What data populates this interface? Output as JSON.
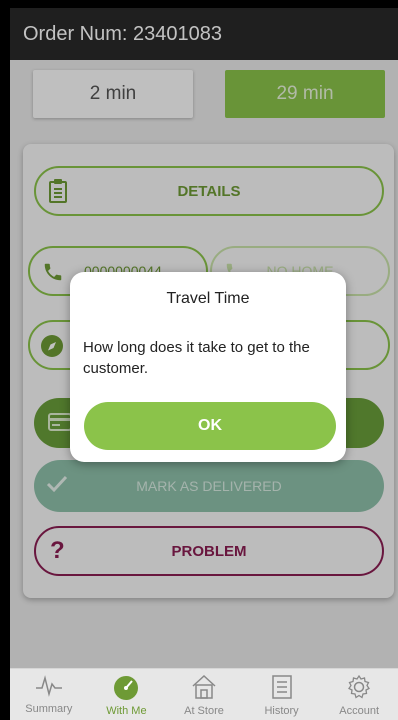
{
  "header": {
    "title": "Order Num: 23401083"
  },
  "times": {
    "left": "2 min",
    "right": "29 min"
  },
  "actions": {
    "details": "DETAILS",
    "phone": "0000000044",
    "no_home": "NO HOME",
    "mark_delivered": "MARK AS DELIVERED",
    "problem": "PROBLEM",
    "problem_icon": "?"
  },
  "dialog": {
    "title": "Travel Time",
    "message": "How long does it take to get to the customer.",
    "ok": "OK"
  },
  "tabs": [
    {
      "label": "Summary",
      "icon": "pulse-icon"
    },
    {
      "label": "With Me",
      "icon": "speedometer-icon"
    },
    {
      "label": "At Store",
      "icon": "store-icon"
    },
    {
      "label": "History",
      "icon": "list-icon"
    },
    {
      "label": "Account",
      "icon": "gear-icon"
    }
  ],
  "colors": {
    "accent": "#8bc34a",
    "dark_green": "#6a9e3a",
    "problem": "#8a1d52",
    "header": "#2a2a2a"
  }
}
